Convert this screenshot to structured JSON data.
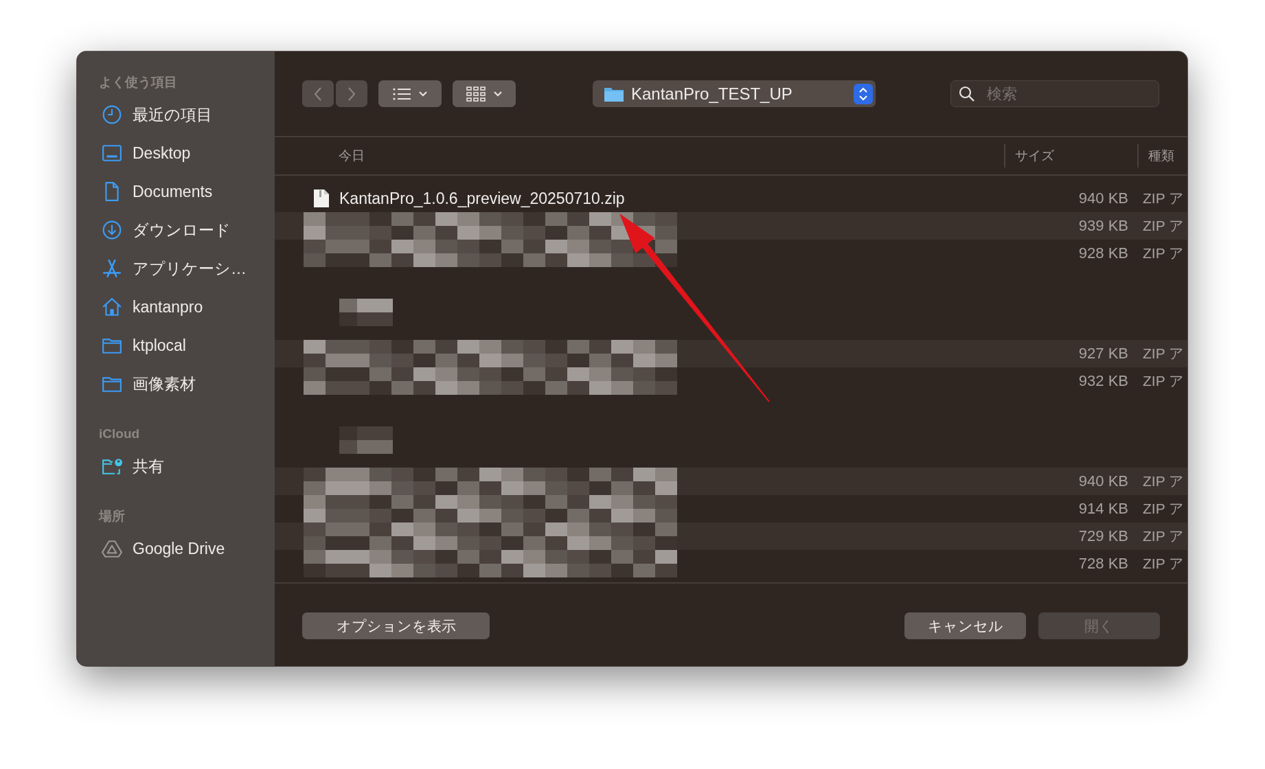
{
  "sidebar": {
    "sections": [
      {
        "heading": "よく使う項目",
        "items": [
          {
            "label": "最近の項目",
            "kind": "clock"
          },
          {
            "label": "Desktop",
            "kind": "desktop"
          },
          {
            "label": "Documents",
            "kind": "document"
          },
          {
            "label": "ダウンロード",
            "kind": "download"
          },
          {
            "label": "アプリケーシ…",
            "kind": "apps"
          },
          {
            "label": "kantanpro",
            "kind": "home"
          },
          {
            "label": "ktplocal",
            "kind": "folder"
          },
          {
            "label": "画像素材",
            "kind": "folder"
          }
        ]
      },
      {
        "heading": "iCloud",
        "items": [
          {
            "label": "共有",
            "kind": "shared"
          }
        ]
      },
      {
        "heading": "場所",
        "items": [
          {
            "label": "Google Drive",
            "kind": "drive"
          }
        ]
      }
    ]
  },
  "location": {
    "folder": "KantanPro_TEST_UP"
  },
  "search": {
    "placeholder": "検索"
  },
  "columns": [
    {
      "label": "今日"
    },
    {
      "label": "サイズ"
    },
    {
      "label": "種類"
    }
  ],
  "list": [
    {
      "kind": "file",
      "name": "KantanPro_1.0.6_preview_20250710.zip",
      "size": "940 KB",
      "file_type": "ZIP ア"
    },
    {
      "kind": "redacted",
      "size": "939 KB",
      "file_type": "ZIP ア"
    },
    {
      "kind": "redacted",
      "size": "928 KB",
      "file_type": "ZIP ア"
    },
    {
      "kind": "gap"
    },
    {
      "kind": "redacted",
      "size": "927 KB",
      "file_type": "ZIP ア"
    },
    {
      "kind": "redacted",
      "size": "932 KB",
      "file_type": "ZIP ア"
    },
    {
      "kind": "gap"
    },
    {
      "kind": "redacted",
      "size": "940 KB",
      "file_type": "ZIP ア"
    },
    {
      "kind": "redacted",
      "size": "914 KB",
      "file_type": "ZIP ア"
    },
    {
      "kind": "redacted",
      "size": "729 KB",
      "file_type": "ZIP ア"
    },
    {
      "kind": "redacted",
      "size": "728 KB",
      "file_type": "ZIP ア"
    }
  ],
  "buttons": [
    {
      "label": "オプションを表示",
      "disabled": false
    },
    {
      "label": "キャンセル",
      "disabled": false
    },
    {
      "label": "開く",
      "disabled": true
    }
  ],
  "annotation_arrow": true
}
